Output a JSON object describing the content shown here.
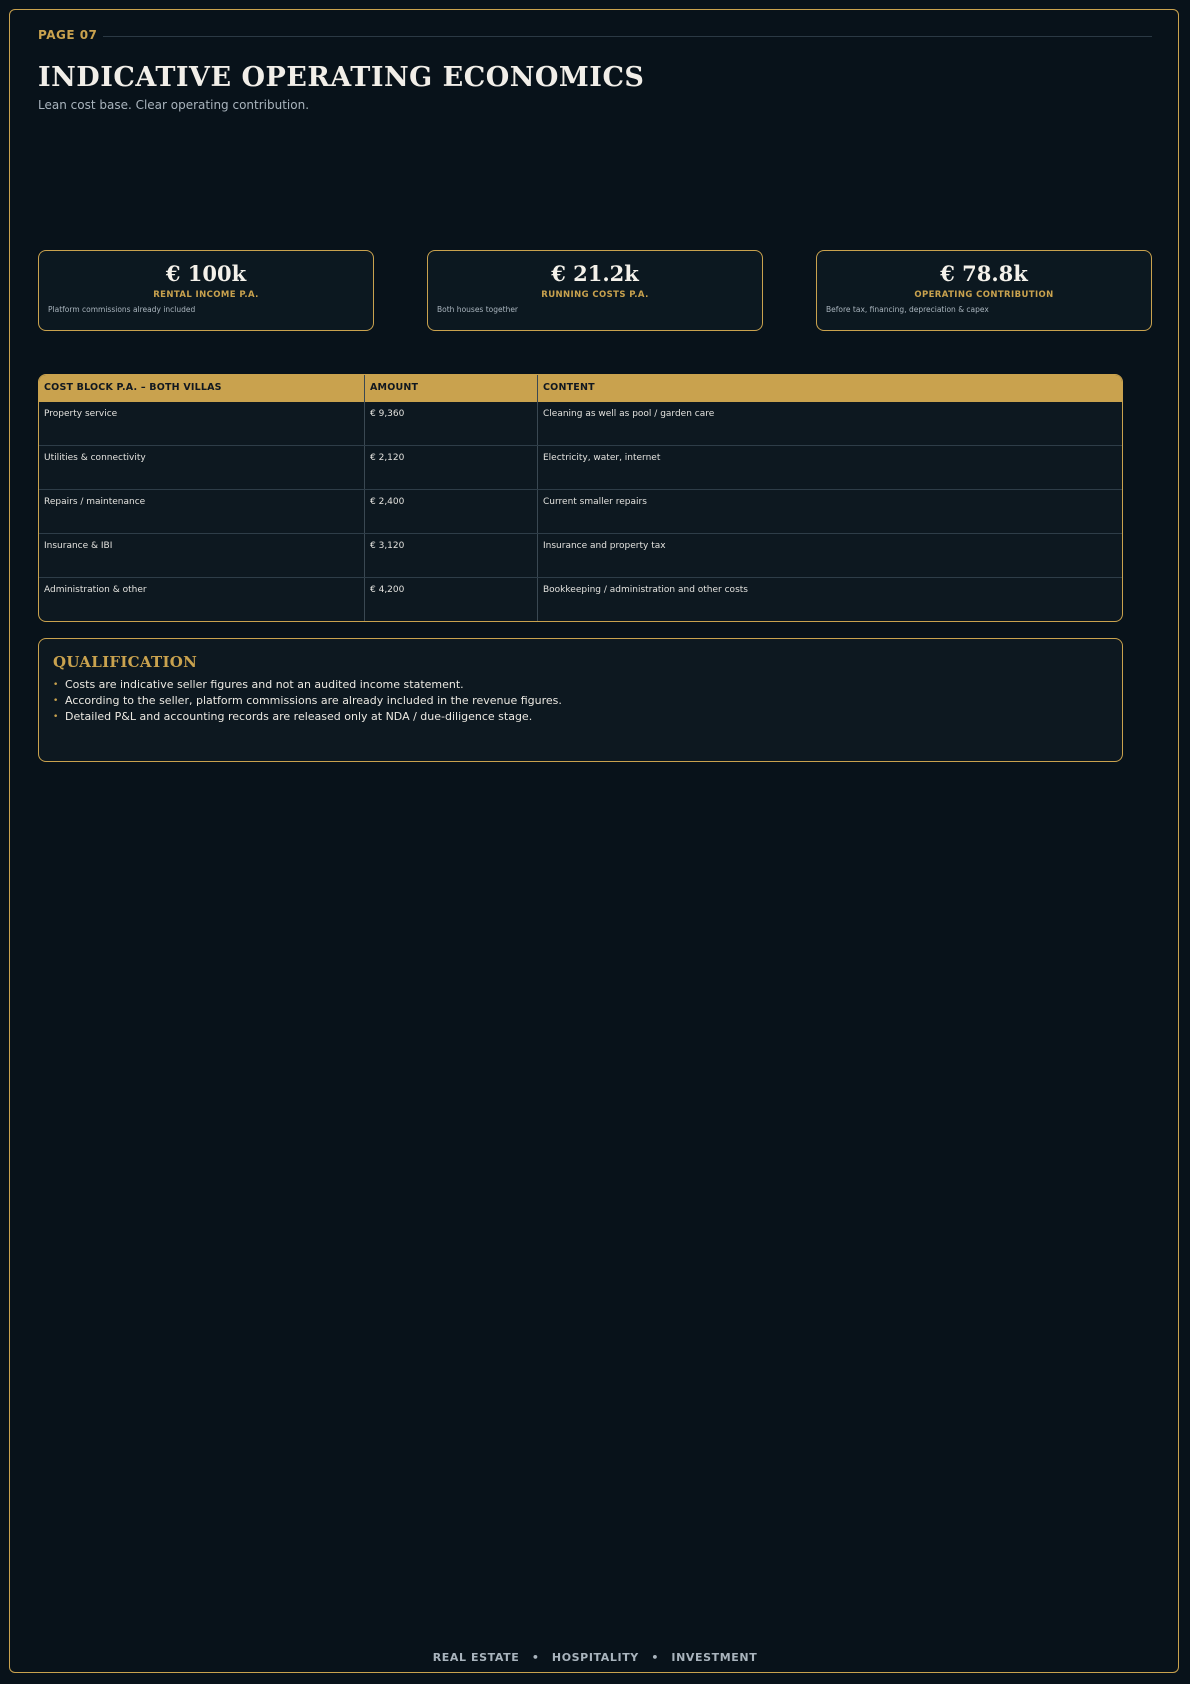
{
  "page": {
    "label": "PAGE 07",
    "title": "INDICATIVE OPERATING ECONOMICS",
    "subtitle": "Lean cost base. Clear operating contribution."
  },
  "kpis": [
    {
      "value": "€ 100k",
      "label": "RENTAL INCOME P.A.",
      "note": "Platform commissions already included"
    },
    {
      "value": "€ 21.2k",
      "label": "RUNNING COSTS P.A.",
      "note": "Both houses together"
    },
    {
      "value": "€ 78.8k",
      "label": "OPERATING CONTRIBUTION",
      "note": "Before tax, financing, depreciation & capex"
    }
  ],
  "cost_table": {
    "headers": [
      "COST BLOCK P.A. – BOTH VILLAS",
      "AMOUNT",
      "CONTENT"
    ],
    "rows": [
      [
        "Property service",
        "€ 9,360",
        "Cleaning as well as pool / garden care"
      ],
      [
        "Utilities & connectivity",
        "€ 2,120",
        "Electricity, water, internet"
      ],
      [
        "Repairs / maintenance",
        "€ 2,400",
        "Current smaller repairs"
      ],
      [
        "Insurance & IBI",
        "€ 3,120",
        "Insurance and property tax"
      ],
      [
        "Administration & other",
        "€ 4,200",
        "Bookkeeping / administration and other costs"
      ]
    ]
  },
  "qualification": {
    "title": "QUALIFICATION",
    "bullet_symbol": "•",
    "items": [
      "Costs are indicative seller figures and not an audited income statement.",
      "According to the seller, platform commissions are already included in the revenue figures.",
      "Detailed P&L and accounting records are released only at NDA / due-diligence stage."
    ]
  },
  "footer": {
    "items": [
      "REAL ESTATE",
      "HOSPITALITY",
      "INVESTMENT"
    ],
    "separator": "•"
  },
  "colors": {
    "background": "#08121a",
    "accent_gold": "#c9a24e",
    "panel": "#0d1820",
    "text_primary": "#f1eee8",
    "text_muted": "#a9b4bd"
  }
}
